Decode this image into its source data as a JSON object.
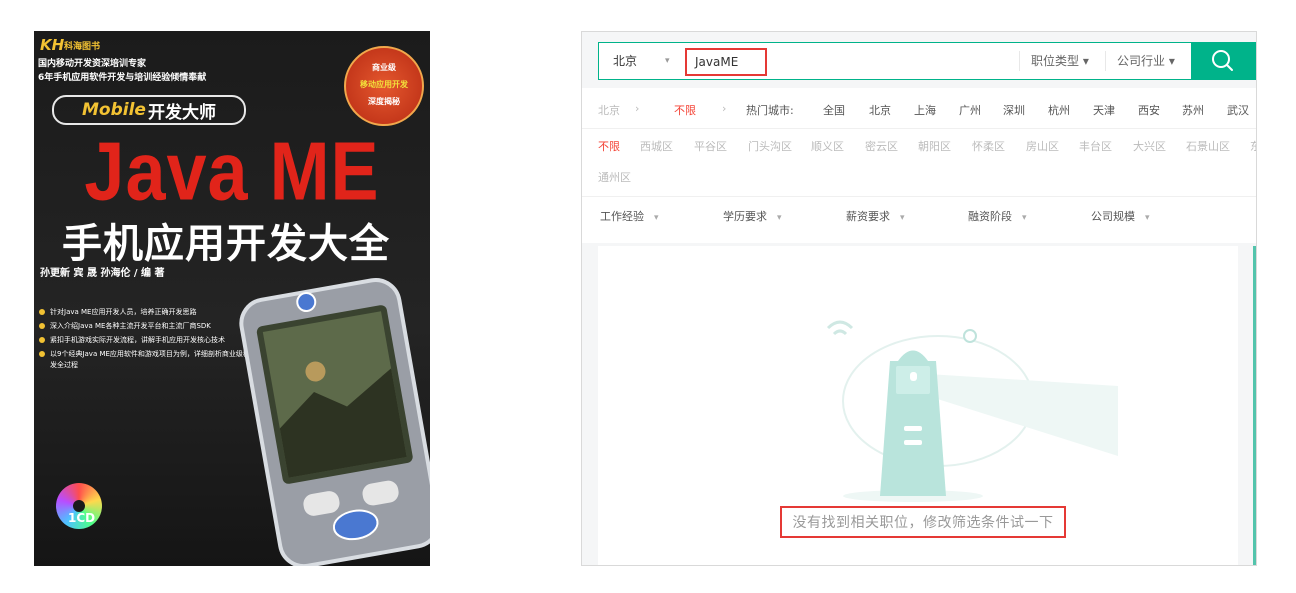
{
  "book": {
    "publisher": "KH",
    "publisher_sub": "科海图书",
    "tagline1": "国内移动开发资深培训专家",
    "tagline2": "6年手机应用软件开发与培训经验倾情奉献",
    "series_en": "Mobile",
    "series_cn": "开发大师",
    "badge_line1": "商业级",
    "badge_line2": "移动应用开发",
    "badge_line3": "深度揭秘",
    "title": "Java ME",
    "subtitle": "手机应用开发大全",
    "authors": "孙更新  宾  晟  孙海伦 / 编  著",
    "bullets": [
      "针对Java ME应用开发人员，培养正确开发思路",
      "深入介绍Java ME各种主流开发平台和主流厂商SDK",
      "紧扣手机游戏实际开发流程，讲解手机应用开发核心技术",
      "以9个经典Java ME应用软件和游戏项目为例，详细剖析商业级移动应用开发全过程"
    ],
    "cd_label": "1CD"
  },
  "search": {
    "city": "北京",
    "query": "JavaME",
    "filter_job_type": "职位类型 ▾",
    "filter_industry": "公司行业 ▾",
    "button_icon": "search-icon"
  },
  "filters": {
    "row1": {
      "city_label": "北京",
      "chevron1": "›",
      "district_any": "不限",
      "chevron2": "›",
      "hot_label": "热门城市:",
      "cities": [
        "全国",
        "北京",
        "上海",
        "广州",
        "深圳",
        "杭州",
        "天津",
        "西安",
        "苏州",
        "武汉"
      ]
    },
    "row2": {
      "districts": [
        "不限",
        "西城区",
        "平谷区",
        "门头沟区",
        "顺义区",
        "密云区",
        "朝阳区",
        "怀柔区",
        "房山区",
        "丰台区",
        "大兴区",
        "石景山区",
        "东"
      ],
      "overflow": "通州区"
    },
    "row3": {
      "dropdowns": [
        "工作经验",
        "学历要求",
        "薪资要求",
        "融资阶段",
        "公司规模"
      ]
    }
  },
  "empty_state": {
    "message": "没有找到相关职位，修改筛选条件试一下",
    "illustration": "lighthouse-illustration"
  },
  "colors": {
    "accent": "#00b38a",
    "highlight_box": "#e53935",
    "active_filter": "#f44336",
    "book_title": "#e1241a",
    "book_gold": "#f2c233"
  }
}
